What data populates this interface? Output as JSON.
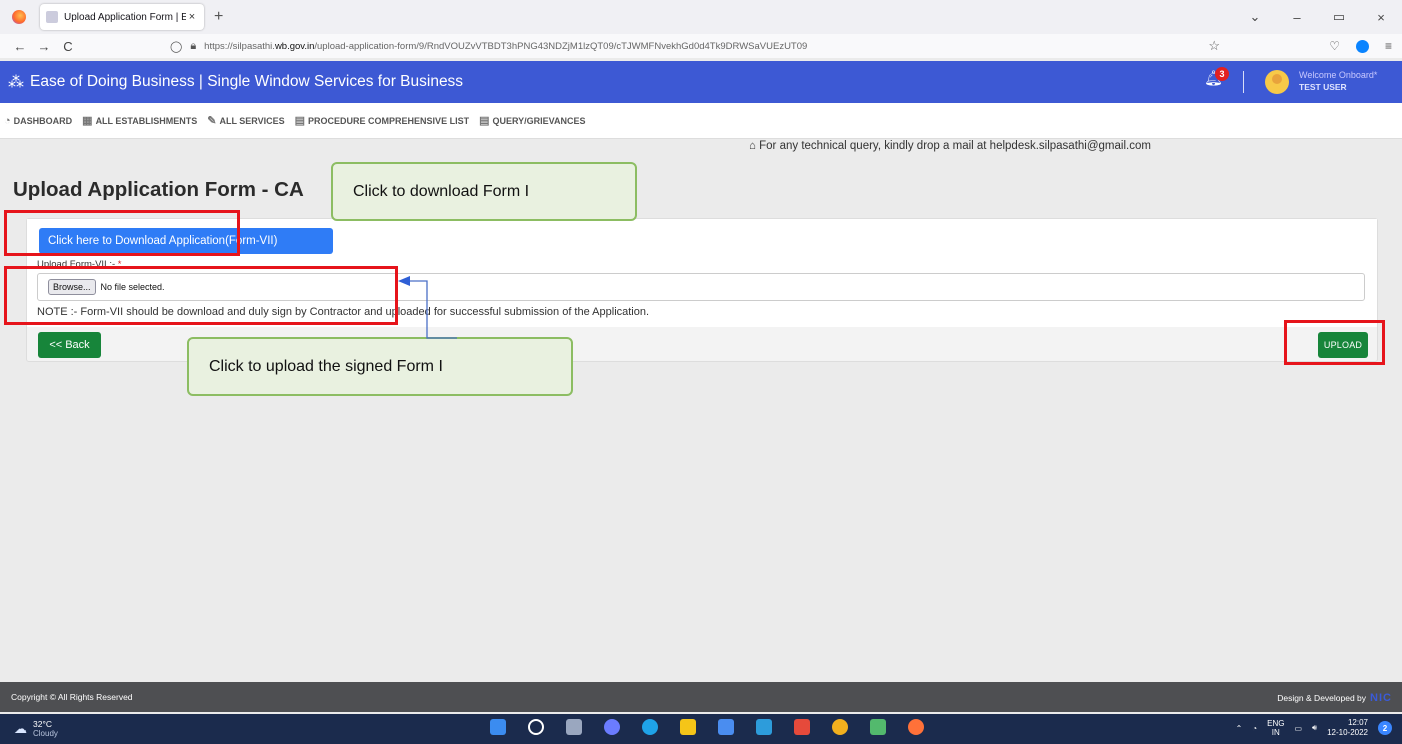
{
  "browser": {
    "tab_title": "Upload Application Form | Ease of d",
    "tab_close": "×",
    "new_tab": "+",
    "url_prefix": "https://silpasathi.",
    "url_domain": "wb.gov.in",
    "url_path": "/upload-application-form/9/RndVOUZvVTBDT3hPNG43NDZjM1lzQT09/cTJWMFNvekhGd0d4Tk9DRWSaVUEzUT09",
    "back": "←",
    "forward": "→",
    "reload": "C",
    "minimize": "–",
    "restore": "▭",
    "close": "×",
    "dropdown": "⌄"
  },
  "header": {
    "logo_icon": "⁂",
    "title": "Ease of Doing Business | Single Window Services for Business",
    "notification_count": "3",
    "welcome": "Welcome Onboard*",
    "user_name": "TEST USER"
  },
  "nav": {
    "items": [
      {
        "icon": "◔",
        "label": "DASHBOARD"
      },
      {
        "icon": "▦",
        "label": "ALL ESTABLISHMENTS"
      },
      {
        "icon": "✎",
        "label": "ALL SERVICES"
      },
      {
        "icon": "▤",
        "label": "PROCEDURE COMPREHENSIVE LIST"
      },
      {
        "icon": "▤",
        "label": "QUERY/GRIEVANCES"
      }
    ]
  },
  "main": {
    "helpline": "⌂ For any technical query, kindly drop a mail at helpdesk.silpasathi@gmail.com",
    "page_title": "Upload Application Form - CA",
    "download_button": "Click here to Download Application(Form-VII)",
    "upload_label": "Upload Form-VII :- ",
    "required_mark": "*",
    "browse_button": "Browse...",
    "no_file": "No file selected.",
    "note": "NOTE :- Form-VII should be download and duly sign by Contractor and uploaded for successful submission of the Application.",
    "back_button": "<< Back",
    "upload_button": "UPLOAD"
  },
  "annotations": {
    "callout_download": "Click to download Form I",
    "callout_upload": "Click to upload the signed Form I",
    "highlight_color": "#e6141b",
    "callout_border": "#8cbd62"
  },
  "footer": {
    "copyright": "Copyright © All Rights Reserved",
    "designed_by": "Design & Developed by",
    "nic": "NIC"
  },
  "taskbar": {
    "temperature": "32°C",
    "condition": "Cloudy",
    "lang_top": "ENG",
    "lang_bottom": "IN",
    "time": "12:07",
    "date": "12-10-2022",
    "notification_badge": "2"
  },
  "colors": {
    "header_blue": "#3d59d4",
    "primary_button": "#2f7cf6",
    "success_button": "#17853a"
  }
}
